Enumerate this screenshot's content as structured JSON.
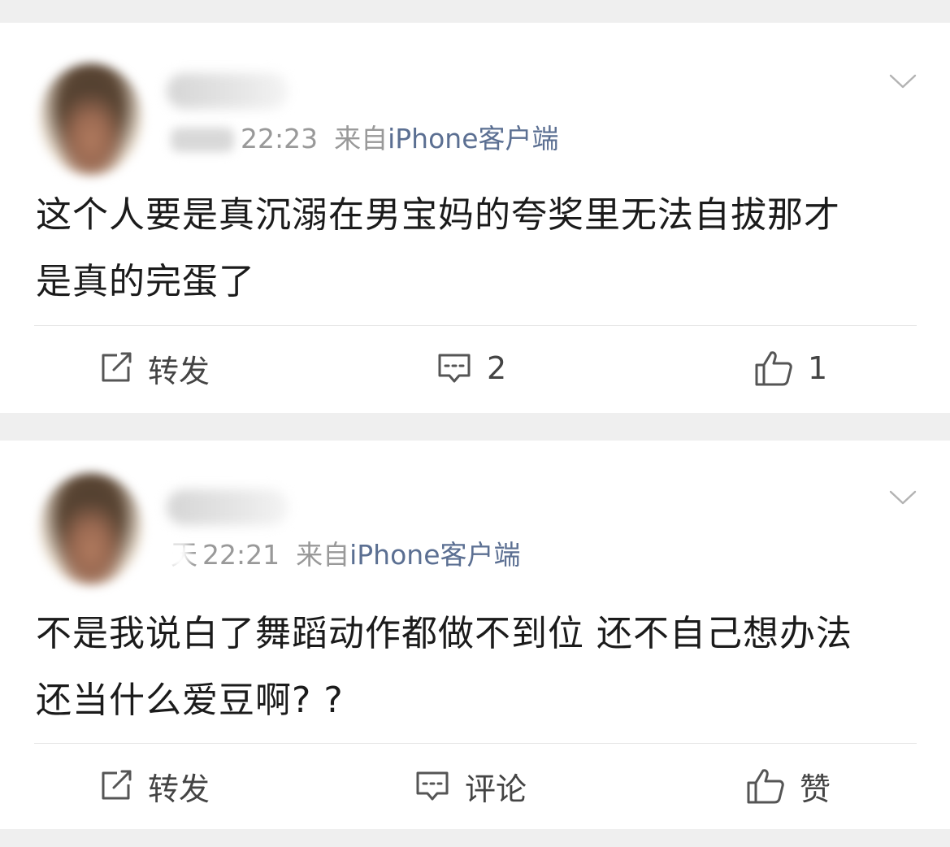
{
  "posts": [
    {
      "time": "22:23",
      "day": "",
      "from_label": "来自",
      "client": "iPhone客户端",
      "content_line1": "这个人要是真沉溺在男宝妈的夸奖里无法自拔那才",
      "content_line2": "是真的完蛋了",
      "repost_label": "转发",
      "comment_label": "2",
      "like_label": "1"
    },
    {
      "time": "22:21",
      "day": "天",
      "from_label": "来自",
      "client": "iPhone客户端",
      "content_line1": "不是我说白了舞蹈动作都做不到位 还不自己想办法",
      "content_line2": "还当什么爱豆啊? ?",
      "repost_label": "转发",
      "comment_label": "评论",
      "like_label": "赞"
    }
  ],
  "colors": {
    "client_link": "#5b6f92",
    "meta_text": "#999999",
    "body_text": "#1b1b1b",
    "action_text": "#444444",
    "background": "#efefef"
  },
  "icons": [
    "chevron-down-icon",
    "repost-icon",
    "comment-icon",
    "like-icon"
  ]
}
